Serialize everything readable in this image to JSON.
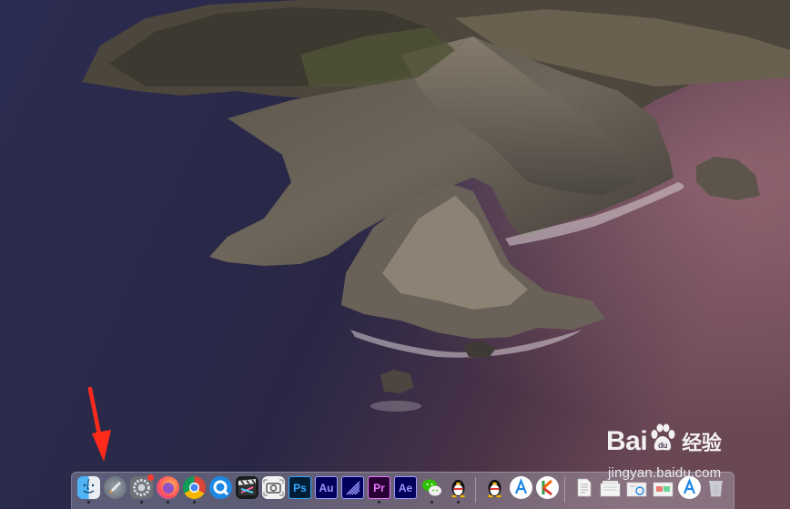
{
  "watermark": {
    "brand": "Bai",
    "brand_tail": "经验",
    "url": "jingyan.baidu.com"
  },
  "annotation": {
    "arrow_color": "#ff2a1a",
    "icon": "red-arrow-down"
  },
  "dock": {
    "items": [
      {
        "name": "finder",
        "icon": "finder-icon",
        "running": true
      },
      {
        "name": "launchpad",
        "icon": "rocket-icon",
        "running": false
      },
      {
        "name": "system-preferences",
        "icon": "gear-icon",
        "running": true,
        "badge": true
      },
      {
        "name": "firefox",
        "icon": "firefox-icon",
        "running": true
      },
      {
        "name": "chrome",
        "icon": "chrome-icon",
        "running": true
      },
      {
        "name": "browser-q",
        "icon": "q-browser-icon",
        "running": false
      },
      {
        "name": "final-cut-pro",
        "icon": "clapper-icon",
        "running": false
      },
      {
        "name": "screenshot",
        "icon": "camera-icon",
        "running": false
      },
      {
        "name": "photoshop",
        "label": "Ps",
        "running": false
      },
      {
        "name": "audition",
        "label": "Au",
        "running": false
      },
      {
        "name": "media-encoder",
        "label": "",
        "running": false
      },
      {
        "name": "premiere",
        "label": "Pr",
        "running": true
      },
      {
        "name": "after-effects",
        "label": "Ae",
        "running": false
      },
      {
        "name": "wechat",
        "icon": "wechat-icon",
        "running": true
      },
      {
        "name": "qq",
        "icon": "penguin-icon",
        "running": true
      },
      {
        "name": "qq-2",
        "icon": "penguin-icon",
        "running": false
      },
      {
        "name": "app-a",
        "icon": "a-app-icon",
        "running": false
      },
      {
        "name": "app-k",
        "icon": "k-app-icon",
        "running": false
      },
      {
        "name": "document",
        "icon": "document-icon",
        "running": false
      },
      {
        "name": "download-stack",
        "icon": "stack-icon",
        "running": false
      },
      {
        "name": "screenshot-stack",
        "icon": "stack-icon",
        "running": false
      },
      {
        "name": "folder-stack",
        "icon": "stack-icon",
        "running": false
      },
      {
        "name": "app-a-2",
        "icon": "a-app-icon",
        "running": false
      },
      {
        "name": "trash",
        "icon": "trash-icon",
        "running": false
      }
    ]
  }
}
